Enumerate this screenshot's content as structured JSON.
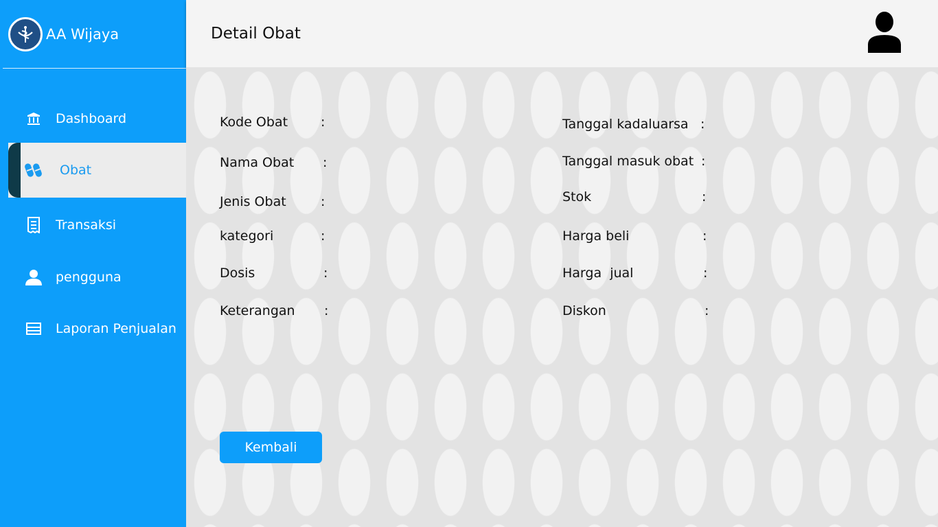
{
  "brand": {
    "name": "AA Wijaya",
    "logo_icon": "pharmacy-caduceus-icon"
  },
  "sidebar": {
    "items": [
      {
        "label": "Dashboard",
        "icon": "bank-icon",
        "active": false
      },
      {
        "label": "Obat",
        "icon": "pills-icon",
        "active": true
      },
      {
        "label": "Transaksi",
        "icon": "receipt-icon",
        "active": false
      },
      {
        "label": "pengguna",
        "icon": "user-icon",
        "active": false
      },
      {
        "label": "Laporan Penjualan",
        "icon": "report-icon",
        "active": false
      }
    ]
  },
  "header": {
    "title": "Detail Obat",
    "avatar_icon": "user-avatar-icon"
  },
  "details": {
    "left": [
      {
        "label": "Kode Obat",
        "colon": ":"
      },
      {
        "label": "Nama Obat",
        "colon": ":"
      },
      {
        "label": "Jenis Obat",
        "colon": ":"
      },
      {
        "label": "kategori",
        "colon": ":"
      },
      {
        "label": "Dosis",
        "colon": ":"
      },
      {
        "label": "Keterangan",
        "colon": ":"
      }
    ],
    "right": [
      {
        "label": "Tanggal kadaluarsa",
        "colon": ":"
      },
      {
        "label": "Tanggal masuk obat",
        "colon": ":"
      },
      {
        "label": "Stok",
        "colon": ":"
      },
      {
        "label": "Harga beli",
        "colon": ":"
      },
      {
        "label": "Harga  jual",
        "colon": ":"
      },
      {
        "label": "Diskon",
        "colon": ":"
      }
    ]
  },
  "actions": {
    "back_label": "Kembali"
  },
  "colors": {
    "primary": "#0d9efa",
    "active_bar": "#0f3a48",
    "header_bg": "#f4f4f4"
  }
}
